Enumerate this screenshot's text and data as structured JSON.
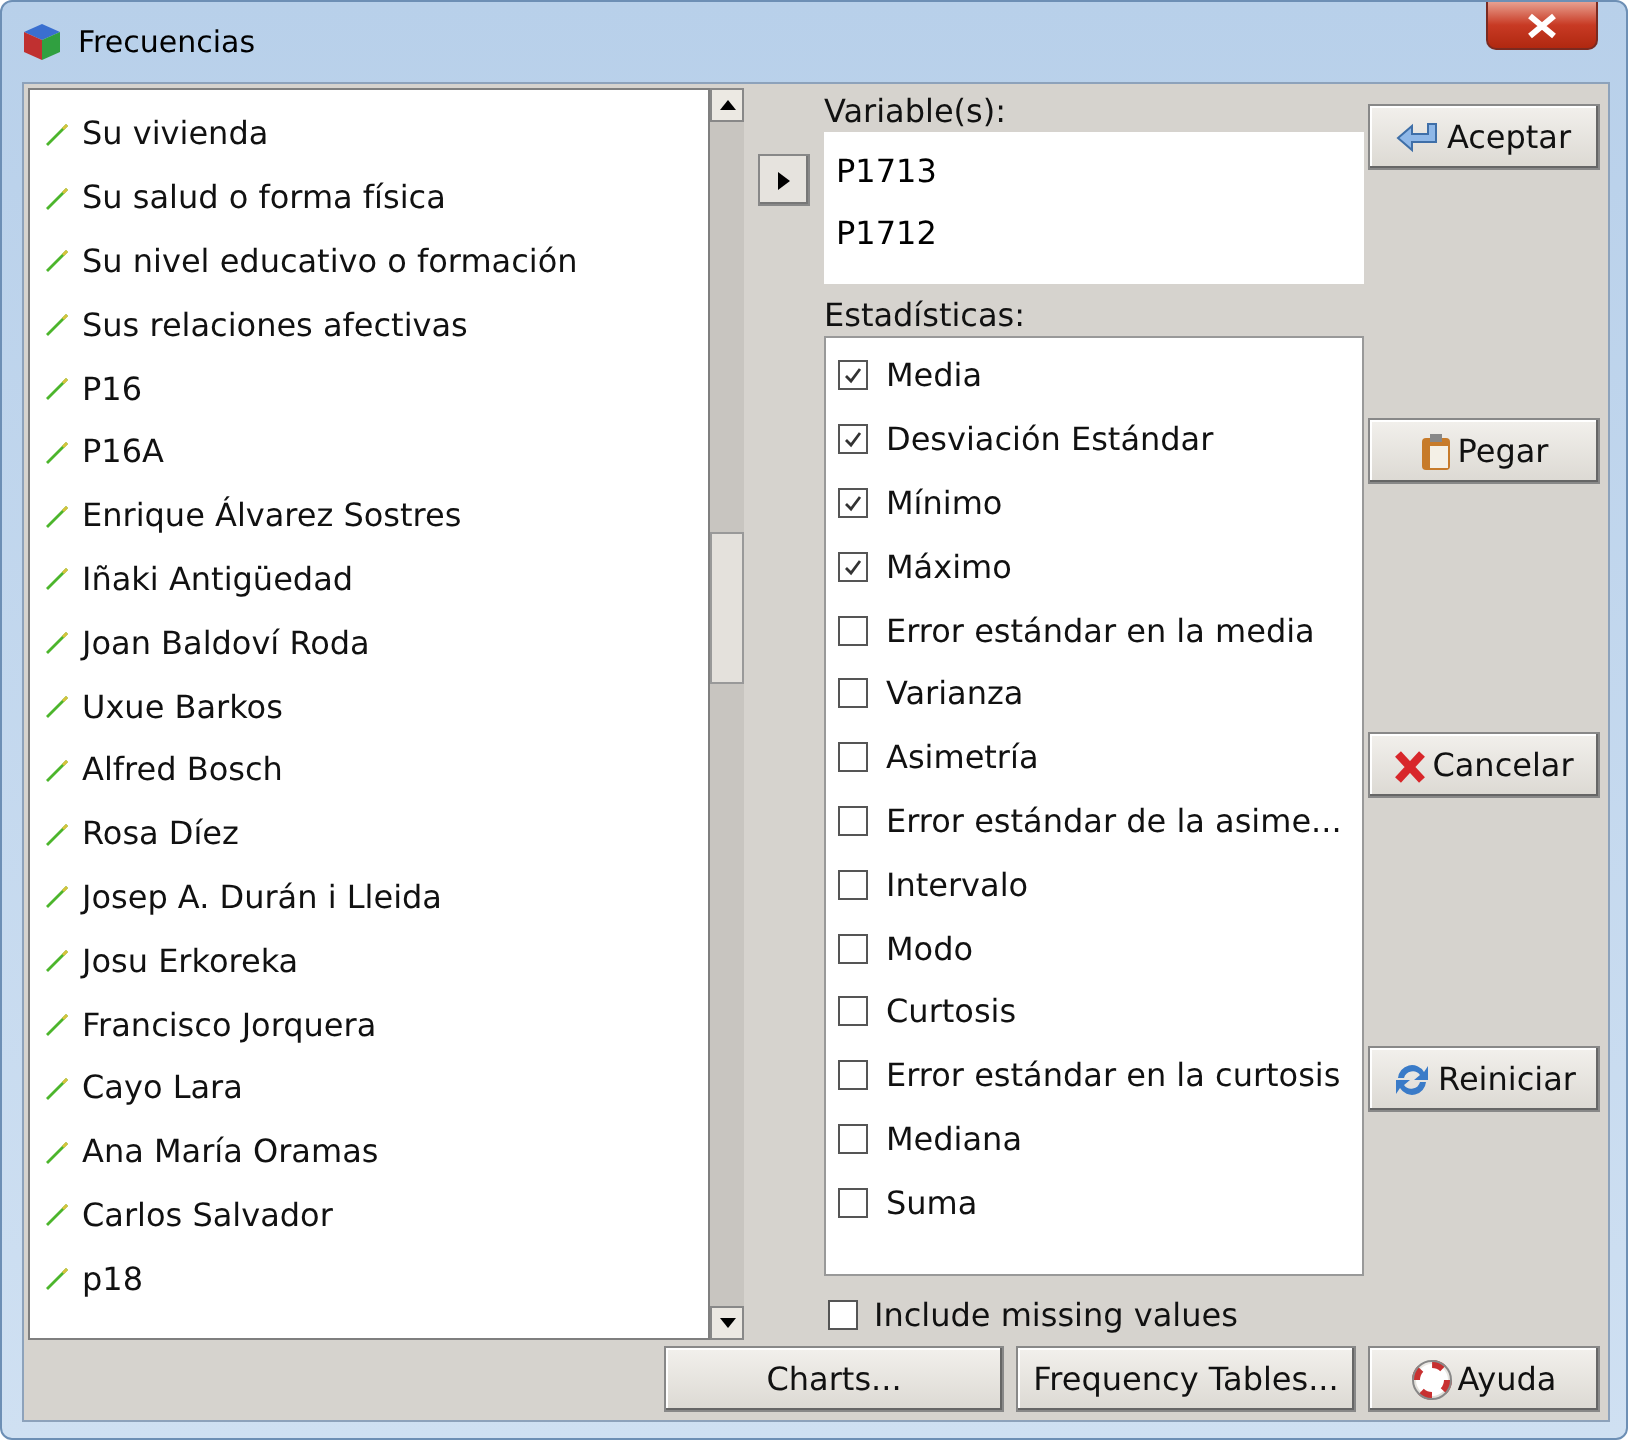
{
  "window": {
    "title": "Frecuencias"
  },
  "variables_list": [
    "Su vivienda",
    "Su salud o forma física",
    "Su nivel educativo o formación",
    "Sus relaciones afectivas",
    "P16",
    "P16A",
    "Enrique Álvarez Sostres",
    "Iñaki Antigüedad",
    "Joan Baldoví Roda",
    "Uxue Barkos",
    "Alfred Bosch",
    "Rosa Díez",
    "Josep A. Durán i Lleida",
    "Josu Erkoreka",
    "Francisco Jorquera",
    "Cayo Lara",
    "Ana María Oramas",
    "Carlos Salvador",
    "p18"
  ],
  "selected_variables": {
    "label": "Variable(s):",
    "items": [
      "P1713",
      "P1712"
    ]
  },
  "statistics": {
    "label": "Estadísticas:",
    "items": [
      {
        "label": "Media",
        "checked": true
      },
      {
        "label": "Desviación Estándar",
        "checked": true
      },
      {
        "label": "Mínimo",
        "checked": true
      },
      {
        "label": "Máximo",
        "checked": true
      },
      {
        "label": "Error estándar en la media",
        "checked": false
      },
      {
        "label": "Varianza",
        "checked": false
      },
      {
        "label": "Asimetría",
        "checked": false
      },
      {
        "label": "Error estándar de la asime...",
        "checked": false
      },
      {
        "label": "Intervalo",
        "checked": false
      },
      {
        "label": "Modo",
        "checked": false
      },
      {
        "label": "Curtosis",
        "checked": false
      },
      {
        "label": "Error estándar en la curtosis",
        "checked": false
      },
      {
        "label": "Mediana",
        "checked": false
      },
      {
        "label": "Suma",
        "checked": false
      }
    ]
  },
  "include_missing": {
    "label": "Include missing values",
    "checked": false
  },
  "side_buttons": [
    {
      "label": "Aceptar",
      "kind": "ok"
    },
    {
      "label": "Pegar",
      "kind": "paste"
    },
    {
      "label": "Cancelar",
      "kind": "cancel"
    },
    {
      "label": "Reiniciar",
      "kind": "reset"
    }
  ],
  "bottom_buttons": [
    {
      "label": "Charts...",
      "kind": "plain"
    },
    {
      "label": "Frequency Tables...",
      "kind": "plain"
    },
    {
      "label": "Ayuda",
      "kind": "help"
    }
  ]
}
